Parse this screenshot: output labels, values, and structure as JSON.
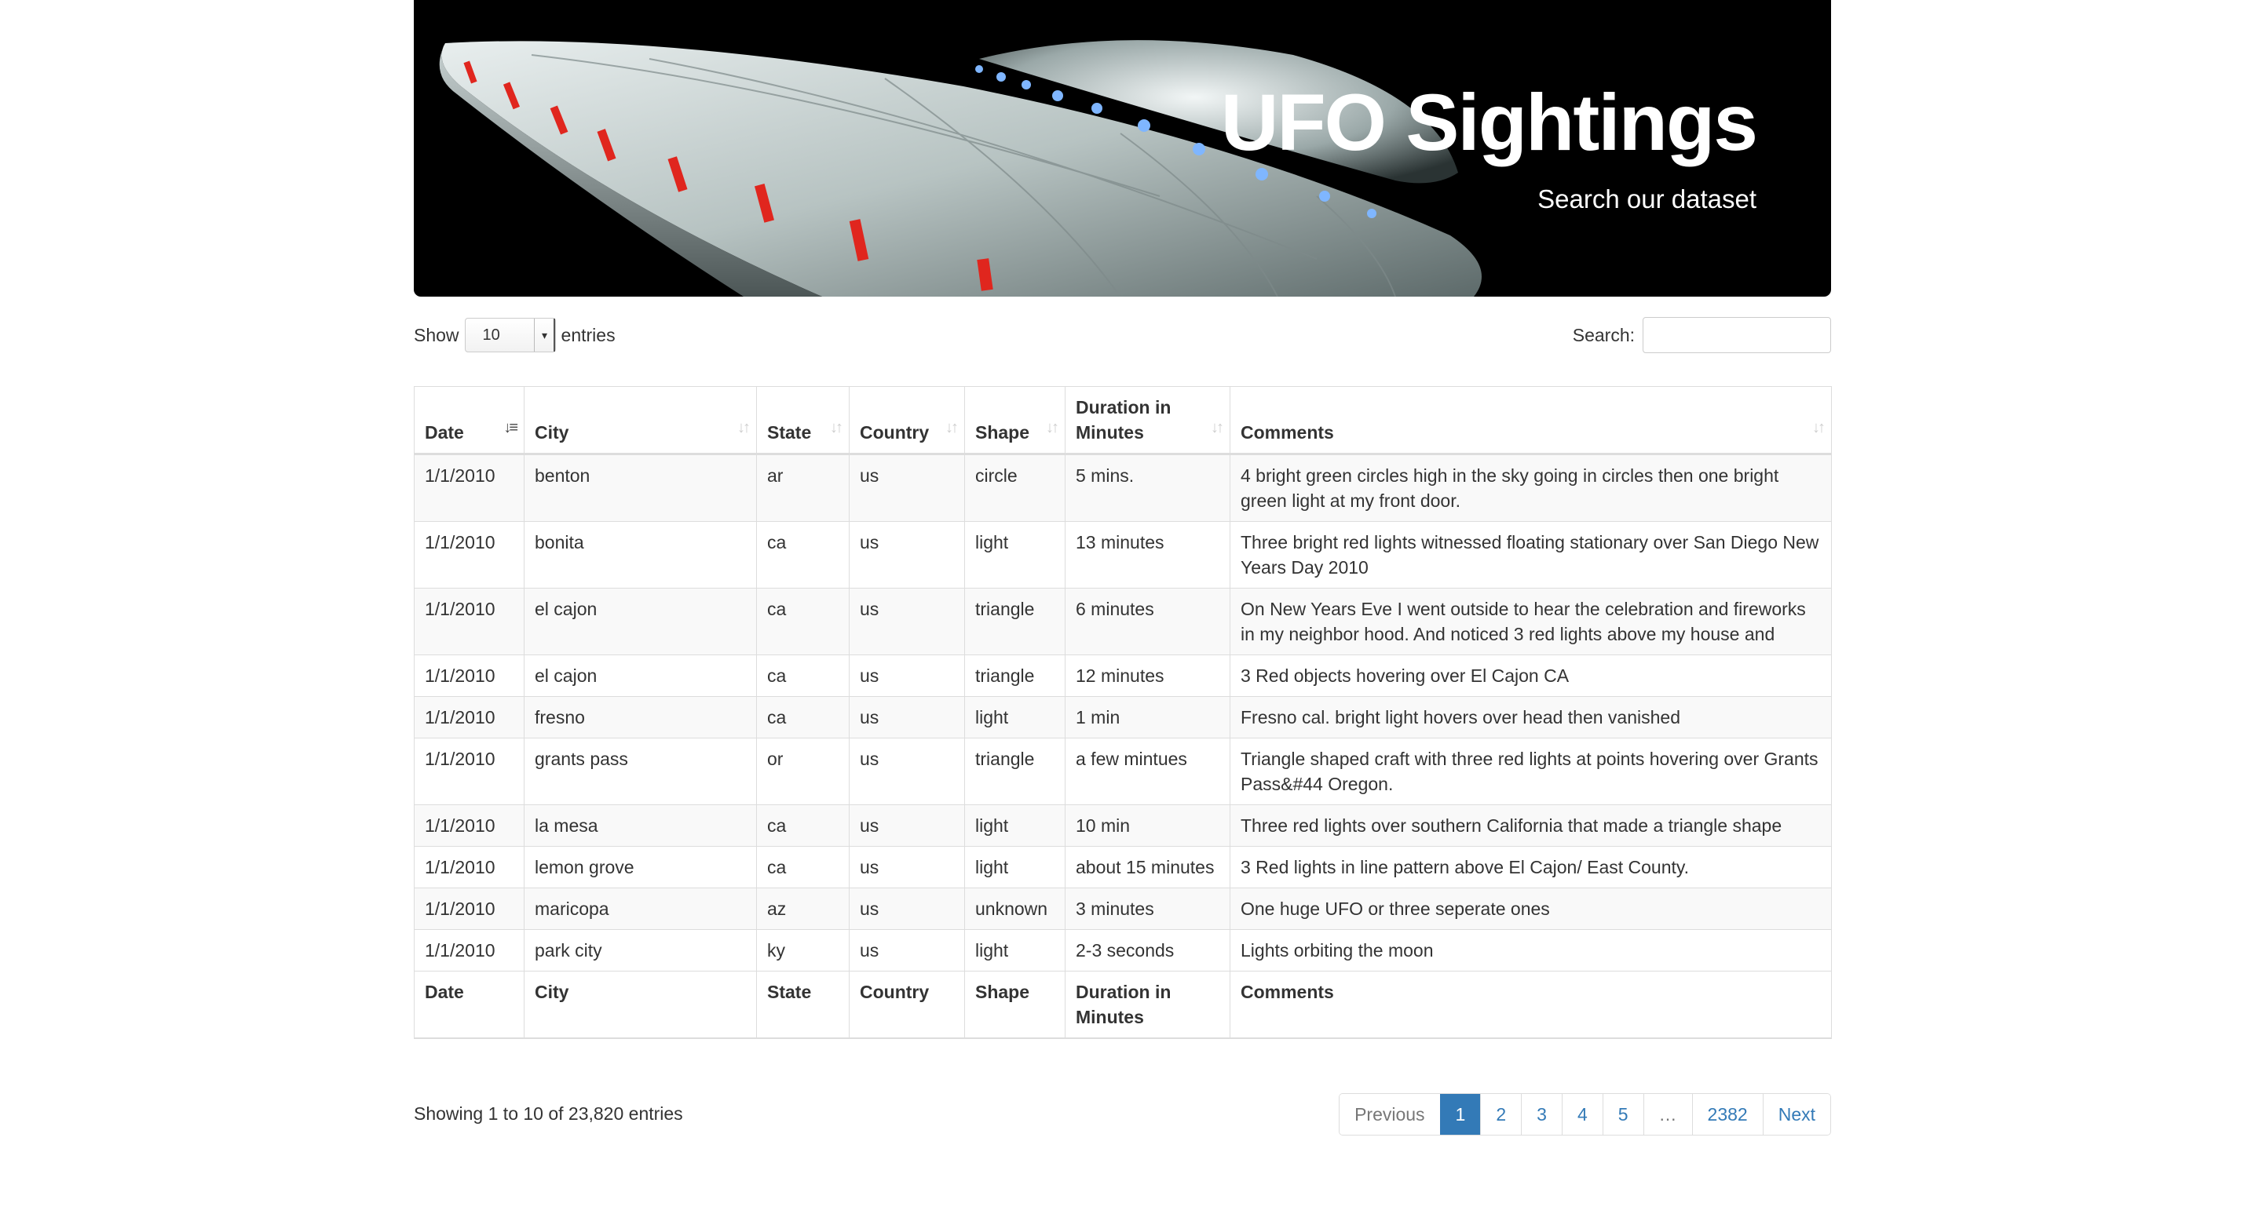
{
  "banner": {
    "title": "UFO Sightings",
    "subtitle": "Search our dataset"
  },
  "controls": {
    "show_label": "Show",
    "entries_label": "entries",
    "page_length": "10",
    "search_label": "Search:",
    "search_value": ""
  },
  "table": {
    "columns": [
      "Date",
      "City",
      "State",
      "Country",
      "Shape",
      "Duration in Minutes",
      "Comments"
    ],
    "rows": [
      [
        "1/1/2010",
        "benton",
        "ar",
        "us",
        "circle",
        "5 mins.",
        "4 bright green circles high in the sky going in circles then one bright green light at my front door."
      ],
      [
        "1/1/2010",
        "bonita",
        "ca",
        "us",
        "light",
        "13 minutes",
        "Three bright red lights witnessed floating stationary over San Diego New Years Day 2010"
      ],
      [
        "1/1/2010",
        "el cajon",
        "ca",
        "us",
        "triangle",
        "6 minutes",
        "On New Years Eve I went outside to hear the celebration and fireworks in my neighbor hood. And noticed 3 red lights above my house and"
      ],
      [
        "1/1/2010",
        "el cajon",
        "ca",
        "us",
        "triangle",
        "12 minutes",
        "3 Red objects hovering over El Cajon CA"
      ],
      [
        "1/1/2010",
        "fresno",
        "ca",
        "us",
        "light",
        "1 min",
        "Fresno cal. bright light hovers over head then vanished"
      ],
      [
        "1/1/2010",
        "grants pass",
        "or",
        "us",
        "triangle",
        "a few mintues",
        "Triangle shaped craft with three red lights at points hovering over Grants Pass&#44 Oregon."
      ],
      [
        "1/1/2010",
        "la mesa",
        "ca",
        "us",
        "light",
        "10 min",
        "Three red lights over southern California that made a triangle shape"
      ],
      [
        "1/1/2010",
        "lemon grove",
        "ca",
        "us",
        "light",
        "about 15 minutes",
        "3 Red lights in line pattern above El Cajon/ East County."
      ],
      [
        "1/1/2010",
        "maricopa",
        "az",
        "us",
        "unknown",
        "3 minutes",
        "One huge UFO or three seperate ones"
      ],
      [
        "1/1/2010",
        "park city",
        "ky",
        "us",
        "light",
        "2-3 seconds",
        "Lights orbiting the moon"
      ]
    ]
  },
  "footer": {
    "info": "Showing 1 to 10 of 23,820 entries",
    "pagination": [
      "Previous",
      "1",
      "2",
      "3",
      "4",
      "5",
      "…",
      "2382",
      "Next"
    ],
    "active_page": "1"
  },
  "colors": {
    "accent": "#337ab7",
    "banner_bg": "#000000",
    "stripe": "#f9f9f9"
  }
}
